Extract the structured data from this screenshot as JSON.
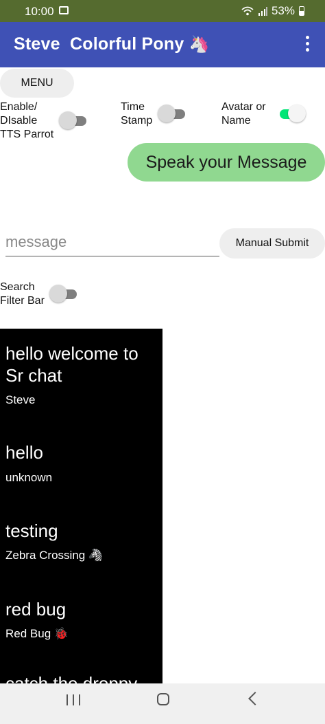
{
  "status_bar": {
    "time": "10:00",
    "battery": "53%"
  },
  "app_bar": {
    "title": "Steve  Colorful Pony",
    "title_emoji": "🦄"
  },
  "menu_button": "MENU",
  "toggles": {
    "tts": {
      "label": "Enable/\nDIsable\nTTS Parrot",
      "state": "off"
    },
    "timestamp": {
      "label": "Time\nStamp",
      "state": "off"
    },
    "avatar": {
      "label": "Avatar or\nName",
      "state": "on"
    },
    "search": {
      "label": "Search\nFilter Bar",
      "state": "off"
    }
  },
  "speak_button": "Speak your Message",
  "message": {
    "placeholder": "message",
    "value": ""
  },
  "submit_button": "Manual Submit",
  "chat": [
    {
      "text": " hello welcome to Sr chat",
      "sender": "Steve"
    },
    {
      "text": " hello",
      "sender": "unknown"
    },
    {
      "text": " testing",
      "sender": " Zebra Crossing 🦓"
    },
    {
      "text": " red bug",
      "sender": " Red Bug 🐞"
    },
    {
      "text": " catch the droppy",
      "sender": ""
    }
  ],
  "colors": {
    "status_bar": "#556b2f",
    "app_bar": "#3f51b5",
    "speak_button": "#90d890",
    "switch_on": "#00e676",
    "chat_background": "#000000"
  },
  "icons": [
    "image-icon",
    "wifi-icon",
    "signal-icon",
    "battery-icon",
    "overflow-menu-icon",
    "recents-icon",
    "home-icon",
    "back-icon"
  ]
}
